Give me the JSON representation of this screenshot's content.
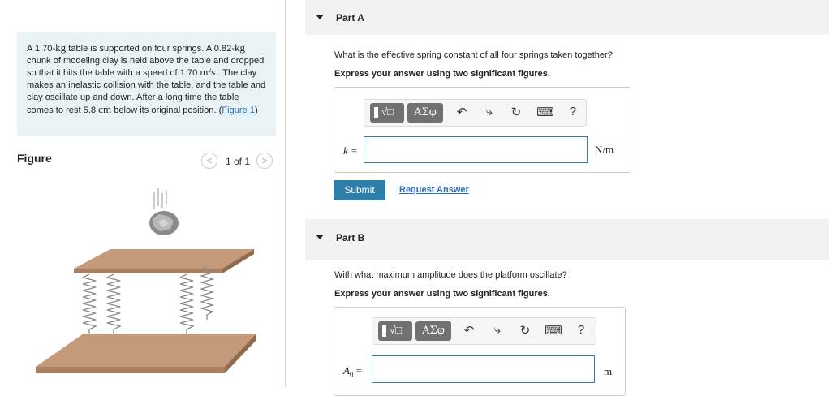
{
  "problem": {
    "segments": [
      {
        "t": "A 1.70-"
      },
      {
        "t": "kg",
        "math": true
      },
      {
        "t": " table is supported on four springs. A 0.82-"
      },
      {
        "t": "kg",
        "math": true
      },
      {
        "t": " chunk of modeling clay is held above the table and dropped so that it hits the table with a speed of 1.70 "
      },
      {
        "t": "m/s",
        "math": true
      },
      {
        "t": " . The clay makes an inelastic collision with the table, and the table and clay oscillate up and down. After a long time the table comes to rest 5.8 "
      },
      {
        "t": "cm",
        "math": true
      },
      {
        "t": " below its original position. ("
      }
    ],
    "figure_link": "Figure 1",
    "close_paren": ")"
  },
  "figure": {
    "title": "Figure",
    "pager": "1 of 1",
    "prev_symbol": "<",
    "next_symbol": ">"
  },
  "part_a": {
    "title": "Part A",
    "question": "What is the effective spring constant of all four springs taken together?",
    "instruction": "Express your answer using two significant figures.",
    "variable": "k =",
    "unit": "N/m",
    "value": ""
  },
  "buttons": {
    "submit": "Submit",
    "request": "Request Answer"
  },
  "part_b": {
    "title": "Part B",
    "question": "With what maximum amplitude does the platform oscillate?",
    "instruction": "Express your answer using two significant figures.",
    "variable": "A",
    "variable_sub": "0",
    "variable_eq": "=",
    "unit": "m",
    "value": ""
  },
  "toolbar": {
    "templates_symbol": "√□",
    "greek": "ΑΣφ",
    "undo": "↶",
    "redo": "⤷",
    "reset": "↻",
    "keyboard": "⌨",
    "help": "?"
  },
  "colors": {
    "accent": "#2d7ea8",
    "problem_bg": "#e9f3f6",
    "header_bg": "#f2f2f2"
  }
}
